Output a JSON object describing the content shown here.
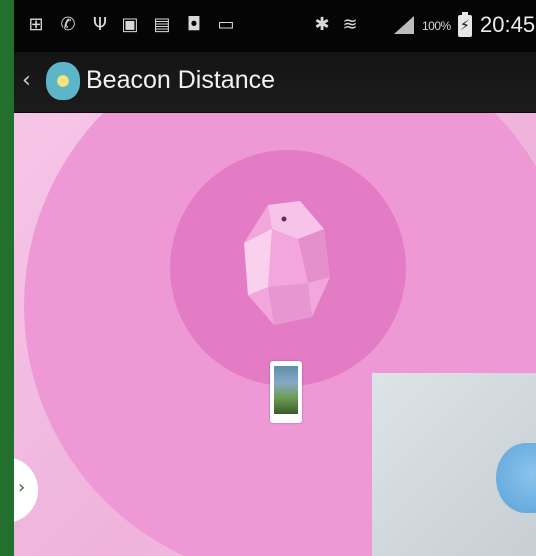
{
  "status_bar": {
    "icons": [
      "notification-plus-icon",
      "missed-call-icon",
      "usb-icon",
      "image-icon",
      "voicemail-icon",
      "android-debug-icon",
      "screen-icon",
      "bluetooth-icon",
      "wifi-icon",
      "signal-icon"
    ],
    "battery_percent": "100%",
    "time": "20:45"
  },
  "action_bar": {
    "title": "Beacon Distance"
  },
  "stage": {
    "colors": {
      "background": "#f1b5dd",
      "outer_ring": "#ee99d6",
      "inner_ring": "#e47cc5",
      "beacon": "#f2a6dc"
    }
  }
}
